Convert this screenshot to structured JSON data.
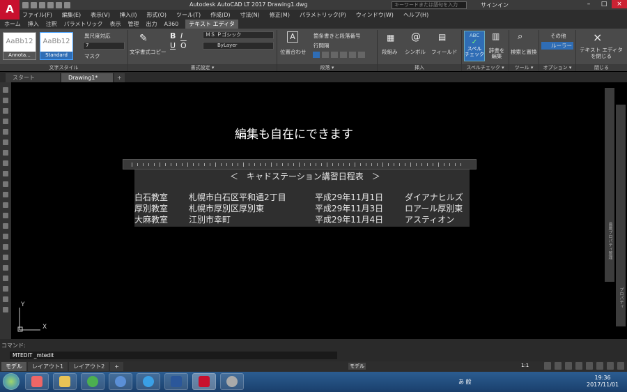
{
  "window": {
    "title": "Autodesk AutoCAD LT 2017    Drawing1.dwg",
    "search_placeholder": "キーワードまたは語句を入力",
    "signin": "サインイン"
  },
  "menu": [
    "ファイル(F)",
    "編集(E)",
    "表示(V)",
    "挿入(I)",
    "形式(O)",
    "ツール(T)",
    "作成(D)",
    "寸法(N)",
    "修正(M)",
    "パラメトリック(P)",
    "ウィンドウ(W)",
    "ヘルプ(H)"
  ],
  "ribbon_tabs": [
    "ホーム",
    "挿入",
    "注釈",
    "パラメトリック",
    "表示",
    "管理",
    "出力",
    "A360",
    "テキスト エディタ"
  ],
  "ribbon": {
    "style_annotative": "Annota...",
    "style_standard": "Standard",
    "style_sample": "AaBb12",
    "annotative_toggle": "異尺度対応",
    "height_value": "7",
    "mask": "マスク",
    "match_format": "文字書式コピー",
    "font": "ＭＳ Ｐゴシック",
    "color": "ByLayer",
    "justify": "位置合わせ",
    "bullets": "箇条書きと段落番号",
    "line_spacing": "行間隔",
    "columns": "段組み",
    "symbol": "シンボル",
    "field": "フィールド",
    "spell_check": "スペル チェック",
    "dictionary": "辞書を 編集",
    "find_replace": "検索と置換",
    "more": "その他",
    "ruler": "ルーラー",
    "close_editor": "テキスト エディタ を閉じる",
    "panel_text_style": "文字スタイル",
    "panel_format": "書式設定 ▾",
    "panel_paragraph": "段落 ▾",
    "panel_insert": "挿入",
    "panel_spell": "スペルチェック ▾",
    "panel_tools": "ツール ▾",
    "panel_options": "オプション ▾",
    "panel_close": "閉じる"
  },
  "doc_tabs": [
    "スタート",
    "Drawing1*"
  ],
  "drawing": {
    "heading": "編集も自在にできます",
    "table_title": "＜　キャドステーション講習日程表　＞",
    "rows": [
      [
        "白石教室",
        "札幌市白石区平和通2丁目",
        "平成29年11月1日",
        "ダイアナヒルズ"
      ],
      [
        "厚別教室",
        "札幌市厚別区厚別東",
        "平成29年11月3日",
        "ロアール厚別東"
      ],
      [
        "大麻教室",
        "江別市幸町",
        "平成29年11月4日",
        "アスティオン"
      ]
    ],
    "ucs_x": "X",
    "ucs_y": "Y"
  },
  "side_palette": {
    "label": "画層プロパティ管理",
    "label2": "プロパティ"
  },
  "command": {
    "label": "コマンド:",
    "current": "MTEDIT _mtedit"
  },
  "layout_tabs": [
    "モデル",
    "レイアウト1",
    "レイアウト2"
  ],
  "status": {
    "model": "モデル",
    "scale": "1:1"
  },
  "clock": {
    "time": "19:36",
    "date": "2017/11/01"
  },
  "tray": "あ 般 ",
  "accent_color": "#c8102e"
}
